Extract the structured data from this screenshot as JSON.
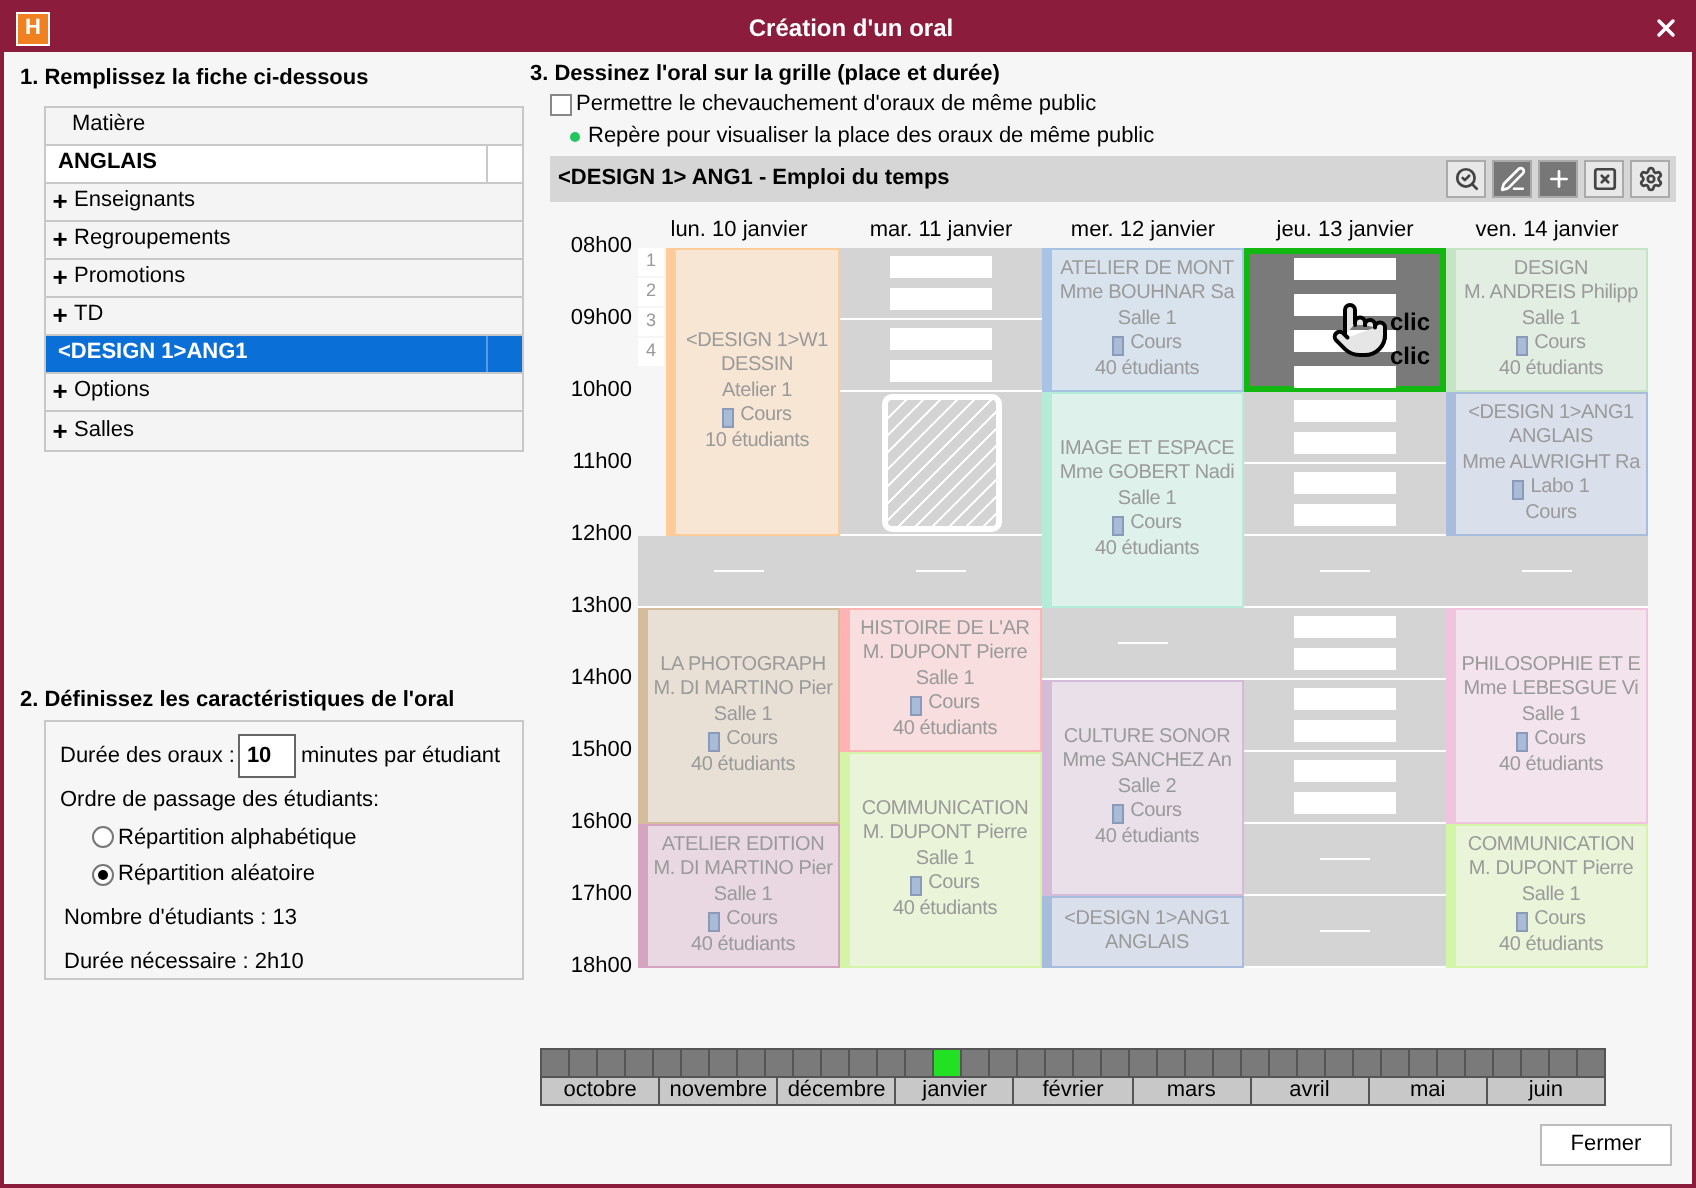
{
  "window": {
    "logo": "H",
    "title": "Création d'un oral"
  },
  "section1": {
    "title": "1. Remplissez la fiche ci-dessous",
    "header": "Matière",
    "rows": [
      {
        "kind": "value",
        "label": "ANGLAIS",
        "selected": false
      },
      {
        "kind": "category",
        "expander": "+",
        "label": "Enseignants"
      },
      {
        "kind": "category",
        "expander": "+",
        "label": "Regroupements"
      },
      {
        "kind": "category",
        "expander": "+",
        "label": "Promotions"
      },
      {
        "kind": "category",
        "expander": "+",
        "label": "TD"
      },
      {
        "kind": "value",
        "label": "<DESIGN 1>ANG1",
        "selected": true
      },
      {
        "kind": "category",
        "expander": "+",
        "label": "Options"
      },
      {
        "kind": "category",
        "expander": "+",
        "label": "Salles"
      }
    ]
  },
  "section2": {
    "title": "2. Définissez les caractéristiques de l'oral",
    "duration_label": "Durée des oraux :",
    "duration_value": "10",
    "duration_unit": "minutes par étudiant",
    "order_label": "Ordre de passage des étudiants:",
    "options": [
      {
        "label": "Répartition alphabétique",
        "selected": false
      },
      {
        "label": "Répartition aléatoire",
        "selected": true
      }
    ],
    "students": "Nombre d'étudiants : 13",
    "needed": "Durée nécessaire : 2h10"
  },
  "section3": {
    "title": "3. Dessinez l'oral sur la grille (place et durée)",
    "overlap": {
      "label": "Permettre le chevauchement d'oraux de même public",
      "checked": false
    },
    "legend": {
      "label": "Repère pour visualiser la place des oraux de même public",
      "color": "#22c55e"
    },
    "grid_title": "<DESIGN 1> ANG1 - Emploi du temps"
  },
  "grid": {
    "hours": [
      "08h00",
      "09h00",
      "10h00",
      "11h00",
      "12h00",
      "13h00",
      "14h00",
      "15h00",
      "16h00",
      "17h00",
      "18h00"
    ],
    "slot_numbers": [
      "1",
      "2",
      "3",
      "4"
    ],
    "days": [
      {
        "label": "lun. 10 janvier",
        "slots": [
          {
            "kind": "course",
            "color": "#ffcc99",
            "lines": [
              "<DESIGN 1>W1",
              "DESSIN",
              "Atelier 1",
              "Cours",
              "10 étudiants"
            ]
          },
          {
            "kind": "span"
          },
          {
            "kind": "span"
          },
          {
            "kind": "span"
          },
          {
            "kind": "empty"
          },
          {
            "kind": "course",
            "color": "#d4bc9c",
            "lines": [
              "LA PHOTOGRAPH",
              "M. DI MARTINO Pier",
              "Salle 1",
              "Cours",
              "40 étudiants"
            ]
          },
          {
            "kind": "span"
          },
          {
            "kind": "span"
          },
          {
            "kind": "course",
            "color": "#d4a4c0",
            "lines": [
              "ATELIER EDITION",
              "M. DI MARTINO Pier",
              "Salle 1",
              "Cours",
              "40 étudiants"
            ]
          },
          {
            "kind": "span"
          }
        ]
      },
      {
        "label": "mar. 11 janvier",
        "slots": [
          {
            "kind": "free"
          },
          {
            "kind": "free"
          },
          {
            "kind": "hatched"
          },
          {
            "kind": "hatched"
          },
          {
            "kind": "empty"
          },
          {
            "kind": "course",
            "color": "#ffb4b4",
            "lines": [
              "HISTOIRE DE L'AR",
              "M. DUPONT Pierre",
              "Salle 1",
              "Cours",
              "40 étudiants"
            ]
          },
          {
            "kind": "span"
          },
          {
            "kind": "course",
            "color": "#d4f4a8",
            "lines": [
              "COMMUNICATION",
              "M. DUPONT Pierre",
              "Salle 1",
              "Cours",
              "40 étudiants"
            ]
          },
          {
            "kind": "span"
          },
          {
            "kind": "span"
          }
        ]
      },
      {
        "label": "mer. 12 janvier",
        "slots": [
          {
            "kind": "course",
            "color": "#a8c4e4",
            "lines": [
              "ATELIER DE MONT",
              "Mme BOUHNAR Sa",
              "Salle 1",
              "Cours",
              "40 étudiants"
            ]
          },
          {
            "kind": "span"
          },
          {
            "kind": "course",
            "color": "#b4ecd8",
            "lines": [
              "IMAGE ET ESPACE",
              "Mme GOBERT Nadi",
              "Salle 1",
              "Cours",
              "40 étudiants"
            ]
          },
          {
            "kind": "span"
          },
          {
            "kind": "span"
          },
          {
            "kind": "empty"
          },
          {
            "kind": "course",
            "color": "#d4bcd8",
            "lines": [
              "CULTURE SONOR",
              "Mme SANCHEZ An",
              "Salle 2",
              "Cours",
              "40 étudiants"
            ]
          },
          {
            "kind": "span"
          },
          {
            "kind": "span"
          },
          {
            "kind": "course",
            "color": "#a8bcdc",
            "lines": [
              "<DESIGN 1>ANG1",
              "ANGLAIS"
            ]
          }
        ]
      },
      {
        "label": "jeu. 13 janvier",
        "slots": [
          {
            "kind": "selection",
            "labels": [
              "clic",
              "clic"
            ]
          },
          {
            "kind": "selection"
          },
          {
            "kind": "free"
          },
          {
            "kind": "free"
          },
          {
            "kind": "empty"
          },
          {
            "kind": "free"
          },
          {
            "kind": "free"
          },
          {
            "kind": "free"
          },
          {
            "kind": "empty"
          },
          {
            "kind": "empty"
          }
        ]
      },
      {
        "label": "ven. 14 janvier",
        "slots": [
          {
            "kind": "course",
            "color": "#c4e4c4",
            "lines": [
              "DESIGN",
              "M. ANDREIS Philipp",
              "Salle 1",
              "Cours",
              "40 étudiants"
            ]
          },
          {
            "kind": "span"
          },
          {
            "kind": "course",
            "color": "#a8bcdc",
            "lines": [
              "<DESIGN 1>ANG1",
              "ANGLAIS",
              "Mme ALWRIGHT Ra",
              "Labo 1",
              "Cours"
            ]
          },
          {
            "kind": "span"
          },
          {
            "kind": "empty"
          },
          {
            "kind": "course",
            "color": "#f0c4dc",
            "lines": [
              "PHILOSOPHIE ET E",
              "Mme LEBESGUE Vi",
              "Salle 1",
              "Cours",
              "40 étudiants"
            ]
          },
          {
            "kind": "span"
          },
          {
            "kind": "span"
          },
          {
            "kind": "course",
            "color": "#d4f4a8",
            "lines": [
              "COMMUNICATION",
              "M. DUPONT Pierre",
              "Salle 1",
              "Cours",
              "40 étudiants"
            ]
          },
          {
            "kind": "span"
          }
        ]
      }
    ]
  },
  "timeline": {
    "weeks": [
      {
        "selected": false
      },
      {
        "selected": false
      },
      {
        "selected": false
      },
      {
        "selected": false
      },
      {
        "selected": false
      },
      {
        "selected": false
      },
      {
        "selected": false
      },
      {
        "selected": false
      },
      {
        "selected": false
      },
      {
        "selected": false
      },
      {
        "selected": false
      },
      {
        "selected": false
      },
      {
        "selected": false
      },
      {
        "selected": false
      },
      {
        "selected": true
      },
      {
        "selected": false
      },
      {
        "selected": false
      },
      {
        "selected": false
      },
      {
        "selected": false
      },
      {
        "selected": false
      },
      {
        "selected": false
      },
      {
        "selected": false
      },
      {
        "selected": false
      },
      {
        "selected": false
      },
      {
        "selected": false
      },
      {
        "selected": false
      },
      {
        "selected": false
      },
      {
        "selected": false
      },
      {
        "selected": false
      },
      {
        "selected": false
      },
      {
        "selected": false
      },
      {
        "selected": false
      },
      {
        "selected": false
      },
      {
        "selected": false
      },
      {
        "selected": false
      },
      {
        "selected": false
      },
      {
        "selected": false
      },
      {
        "selected": false
      }
    ],
    "months": [
      "octobre",
      "novembre",
      "décembre",
      "janvier",
      "février",
      "mars",
      "avril",
      "mai",
      "juin"
    ]
  },
  "buttons": {
    "close": "Fermer"
  }
}
